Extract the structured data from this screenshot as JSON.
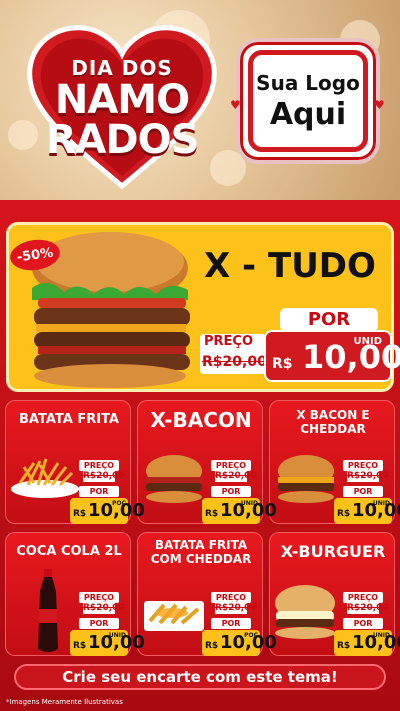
{
  "header": {
    "title_line1": "DIA DOS",
    "title_line2": "NAMO",
    "title_line3": "RADOS",
    "logo_line1": "Sua Logo",
    "logo_line2": "Aqui"
  },
  "featured": {
    "badge": "-50%",
    "name": "X - TUDO",
    "preco_label": "PREÇO",
    "old_price": "R$20,00",
    "por_label": "POR",
    "currency": "R$",
    "price": "10,00",
    "unit": "UNID"
  },
  "products": [
    {
      "name": "BATATA FRITA",
      "preco_label": "PREÇO",
      "old_price": "R$20,00",
      "por_label": "POR",
      "currency": "R$",
      "price": "10,00",
      "unit": "POÇ"
    },
    {
      "name": "X-BACON",
      "preco_label": "PREÇO",
      "old_price": "R$20,00",
      "por_label": "POR",
      "currency": "R$",
      "price": "10,00",
      "unit": "UNID"
    },
    {
      "name": "X BACON E CHEDDAR",
      "preco_label": "PREÇO",
      "old_price": "R$20,00",
      "por_label": "POR",
      "currency": "R$",
      "price": "10,00",
      "unit": "UNID"
    },
    {
      "name": "COCA COLA 2L",
      "preco_label": "PREÇO",
      "old_price": "R$20,00",
      "por_label": "POR",
      "currency": "R$",
      "price": "10,00",
      "unit": "UNID"
    },
    {
      "name": "BATATA FRITA COM CHEDDAR",
      "preco_label": "PREÇO",
      "old_price": "R$20,00",
      "por_label": "POR",
      "currency": "R$",
      "price": "10,00",
      "unit": "POÇ"
    },
    {
      "name": "X-BURGUER",
      "preco_label": "PREÇO",
      "old_price": "R$20,00",
      "por_label": "POR",
      "currency": "R$",
      "price": "10,00",
      "unit": "UNID"
    }
  ],
  "footer": {
    "cta": "Crie seu encarte com este tema!",
    "disclaimer": "*Imagens Meramente Ilustrativas"
  },
  "colors": {
    "primary_red": "#d11a20",
    "yellow": "#fcc21a",
    "gold_bg": "#e6c79c"
  }
}
